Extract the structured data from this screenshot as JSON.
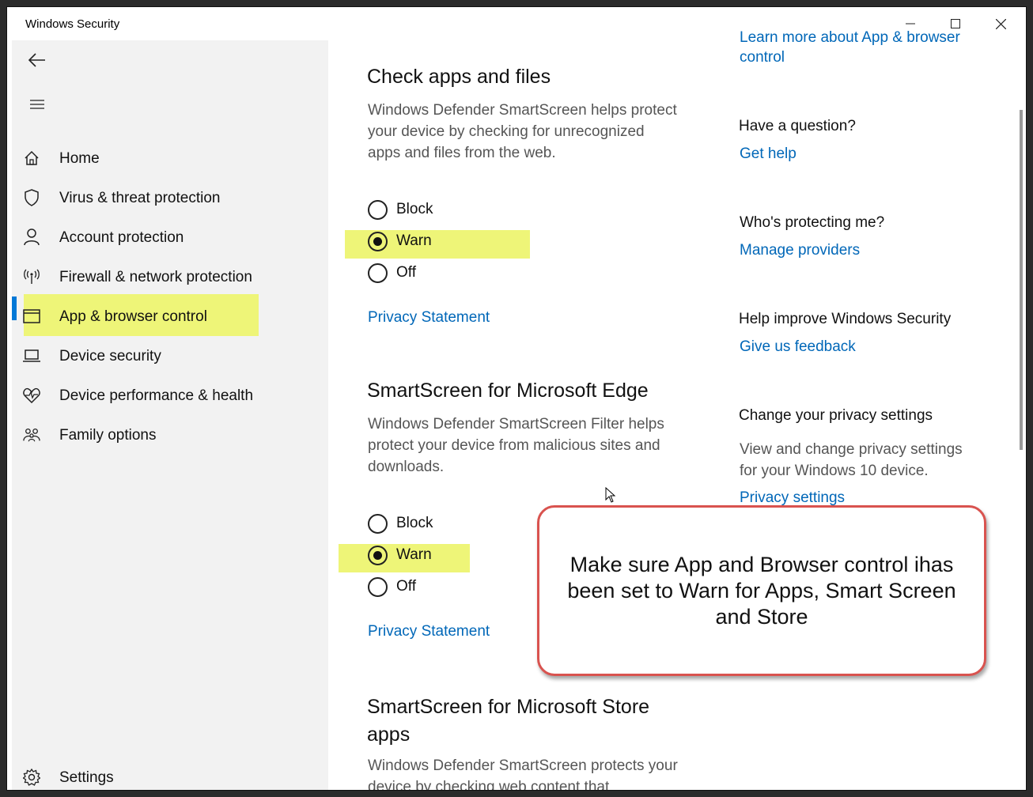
{
  "window": {
    "title": "Windows Security",
    "minimize_icon": "minimize-icon",
    "maximize_icon": "maximize-icon",
    "close_icon": "close-icon"
  },
  "sidebar": {
    "back_icon": "back-arrow-icon",
    "menu_icon": "hamburger-menu-icon",
    "items": [
      {
        "label": "Home",
        "icon": "home-icon"
      },
      {
        "label": "Virus & threat protection",
        "icon": "shield-icon"
      },
      {
        "label": "Account protection",
        "icon": "person-icon"
      },
      {
        "label": "Firewall & network protection",
        "icon": "antenna-icon"
      },
      {
        "label": "App & browser control",
        "icon": "browser-window-icon",
        "selected": true
      },
      {
        "label": "Device security",
        "icon": "laptop-icon"
      },
      {
        "label": "Device performance & health",
        "icon": "heart-pulse-icon"
      },
      {
        "label": "Family options",
        "icon": "family-icon"
      }
    ],
    "settings": {
      "label": "Settings",
      "icon": "gear-icon"
    }
  },
  "main": {
    "sections": [
      {
        "title": "Check apps and files",
        "description_lines": [
          "Windows Defender SmartScreen helps protect",
          "your device by checking for unrecognized",
          "apps and files from the web."
        ],
        "options": [
          "Block",
          "Warn",
          "Off"
        ],
        "selected": "Warn",
        "link": "Privacy Statement"
      },
      {
        "title": "SmartScreen for Microsoft Edge",
        "description_lines": [
          "Windows Defender SmartScreen Filter helps",
          "protect your device from malicious sites and",
          "downloads."
        ],
        "options": [
          "Block",
          "Warn",
          "Off"
        ],
        "selected": "Warn",
        "link": "Privacy Statement"
      },
      {
        "title_lines": [
          "SmartScreen for Microsoft Store",
          "apps"
        ],
        "description_lines": [
          "Windows Defender SmartScreen protects your",
          "device by checking web content that"
        ]
      }
    ]
  },
  "right": {
    "top_link_lines": [
      "Learn more about App & browser",
      "control"
    ],
    "question": {
      "heading": "Have a question?",
      "link": "Get help"
    },
    "protecting": {
      "heading": "Who's protecting me?",
      "link": "Manage providers"
    },
    "improve": {
      "heading": "Help improve Windows Security",
      "link": "Give us feedback"
    },
    "privacy": {
      "heading": "Change your privacy settings",
      "text_lines": [
        "View and change privacy settings",
        "for your Windows 10 device."
      ],
      "link": "Privacy settings"
    }
  },
  "callout": {
    "text": "Make sure App and Browser control ihas been set to Warn for Apps, Smart Screen and Store"
  },
  "colors": {
    "highlight": "#eef578",
    "accent": "#0078d7",
    "link": "#0067b8",
    "callout_border": "#d9534f"
  }
}
